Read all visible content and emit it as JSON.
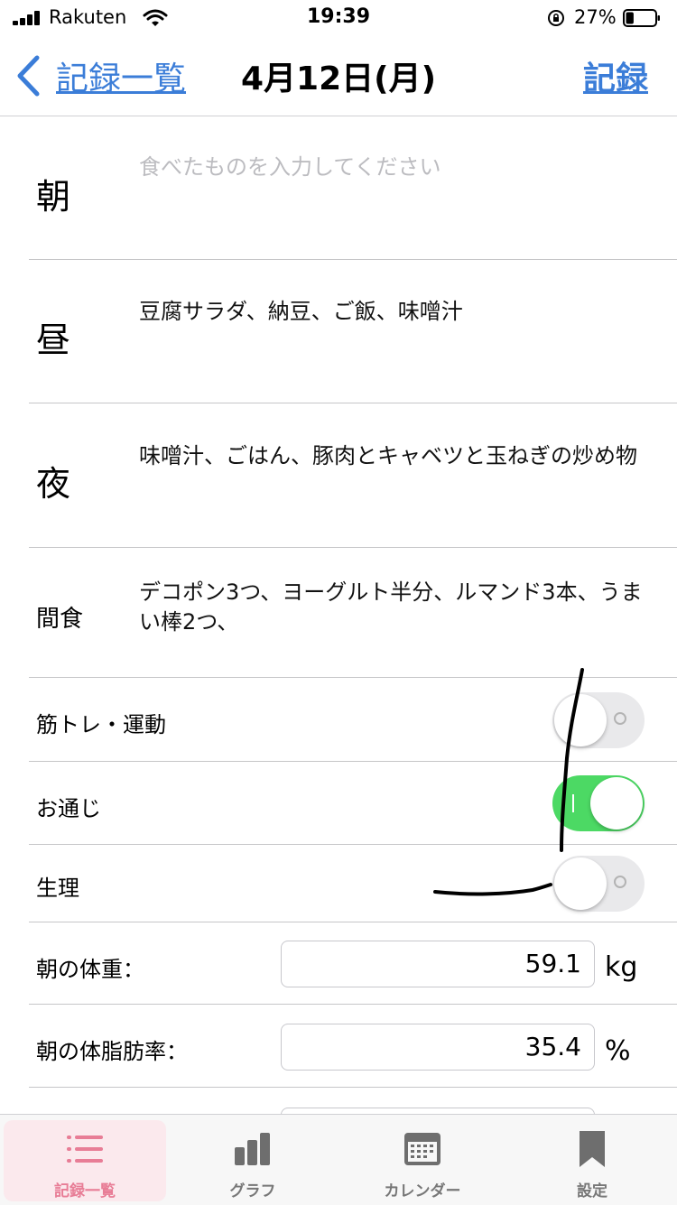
{
  "status_bar": {
    "carrier": "Rakuten",
    "time": "19:39",
    "battery_percent": "27%",
    "battery_level": 0.27,
    "icons": [
      "cellular-signal-icon",
      "wifi-icon",
      "orientation-lock-icon",
      "battery-icon"
    ]
  },
  "nav": {
    "back_label": "記録一覧",
    "title": "4月12日(月)",
    "action_label": "記録"
  },
  "meals": [
    {
      "label": "朝",
      "text": "",
      "placeholder": "食べたものを入力してください"
    },
    {
      "label": "昼",
      "text": "豆腐サラダ、納豆、ご飯、味噌汁"
    },
    {
      "label": "夜",
      "text": "味噌汁、ごはん、豚肉とキャベツと玉ねぎの炒め物"
    },
    {
      "label": "間食",
      "text": "デコポン3つ、ヨーグルト半分、ルマンド3本、うまい棒2つ、"
    }
  ],
  "toggles": [
    {
      "label": "筋トレ・運動",
      "on": false
    },
    {
      "label": "お通じ",
      "on": true
    },
    {
      "label": "生理",
      "on": false
    }
  ],
  "measurements": [
    {
      "label": "朝の体重：",
      "value": "59.1",
      "unit": "kg"
    },
    {
      "label": "朝の体脂肪率：",
      "value": "35.4",
      "unit": "%"
    }
  ],
  "tab_bar": {
    "active": "記録一覧",
    "tabs": [
      {
        "label": "記録一覧",
        "icon": "list-icon"
      },
      {
        "label": "グラフ",
        "icon": "bar-chart-icon"
      },
      {
        "label": "カレンダー",
        "icon": "calendar-icon"
      },
      {
        "label": "設定",
        "icon": "bookmark-icon"
      }
    ]
  },
  "colors": {
    "accent_blue": "#3b7dd8",
    "toggle_on_green": "#4cd964",
    "active_tab_pink": "#e87d96",
    "placeholder_gray": "#bcbcc0"
  }
}
